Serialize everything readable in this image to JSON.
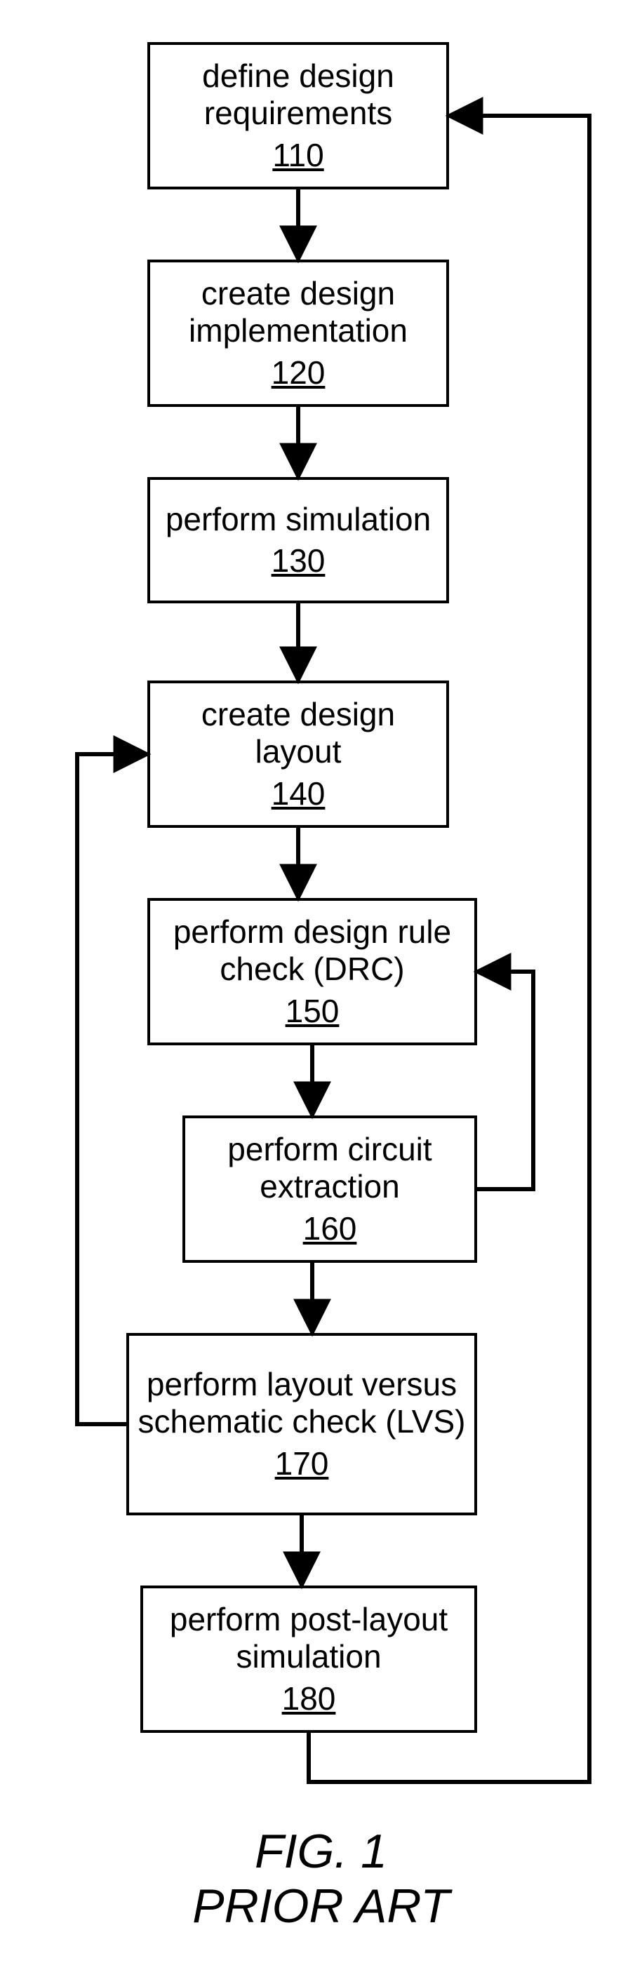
{
  "figure": {
    "caption_line1": "FIG. 1",
    "caption_line2": "PRIOR ART"
  },
  "boxes": {
    "b110": {
      "label": "define design requirements",
      "num": "110"
    },
    "b120": {
      "label": "create design implementation",
      "num": "120"
    },
    "b130": {
      "label": "perform simulation",
      "num": "130"
    },
    "b140": {
      "label": "create design layout",
      "num": "140"
    },
    "b150": {
      "label": "perform design rule check (DRC)",
      "num": "150"
    },
    "b160": {
      "label": "perform circuit extraction",
      "num": "160"
    },
    "b170": {
      "label": "perform layout versus schematic check (LVS)",
      "num": "170"
    },
    "b180": {
      "label": "perform post-layout simulation",
      "num": "180"
    }
  },
  "flow": {
    "type": "flowchart",
    "nodes": [
      "110",
      "120",
      "130",
      "140",
      "150",
      "160",
      "170",
      "180"
    ],
    "edges": [
      {
        "from": "110",
        "to": "120"
      },
      {
        "from": "120",
        "to": "130"
      },
      {
        "from": "130",
        "to": "140"
      },
      {
        "from": "140",
        "to": "150"
      },
      {
        "from": "150",
        "to": "160"
      },
      {
        "from": "160",
        "to": "170"
      },
      {
        "from": "170",
        "to": "180"
      },
      {
        "from": "160",
        "to": "150",
        "kind": "feedback"
      },
      {
        "from": "170",
        "to": "140",
        "kind": "feedback"
      },
      {
        "from": "180",
        "to": "110",
        "kind": "feedback"
      }
    ]
  }
}
